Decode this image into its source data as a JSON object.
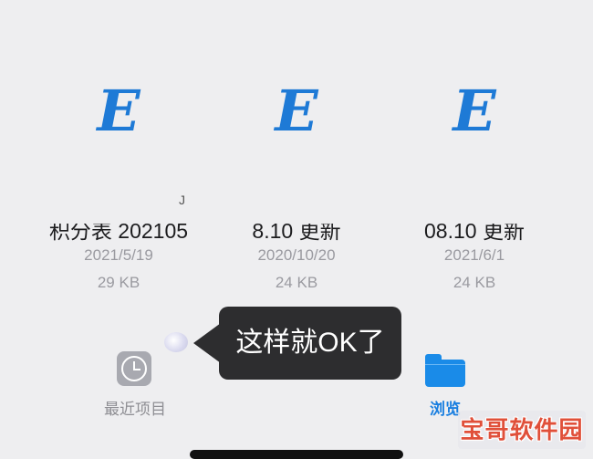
{
  "files": [
    {
      "icon": "E",
      "name": "积分表 202105",
      "date": "2021/5/19",
      "size": "29 KB"
    },
    {
      "icon": "E",
      "name": "8.10 更新",
      "date": "2020/10/20",
      "size": "24 KB"
    },
    {
      "icon": "E",
      "name": "08.10 更新",
      "date": "2021/6/1",
      "size": "24 KB"
    }
  ],
  "stray_mark": "J",
  "tooltip": {
    "text": "这样就OK了"
  },
  "tab_bar": {
    "recent": {
      "label": "最近项目",
      "icon": "clock-icon"
    },
    "browse": {
      "label": "浏览",
      "icon": "folder-icon"
    }
  },
  "watermark": {
    "text": "宝哥软件园"
  },
  "colors": {
    "accent": "#1a7fe0",
    "excel_icon": "#1e7ad6",
    "tooltip_bg": "#2d2d2f",
    "background": "#eeeef0"
  }
}
